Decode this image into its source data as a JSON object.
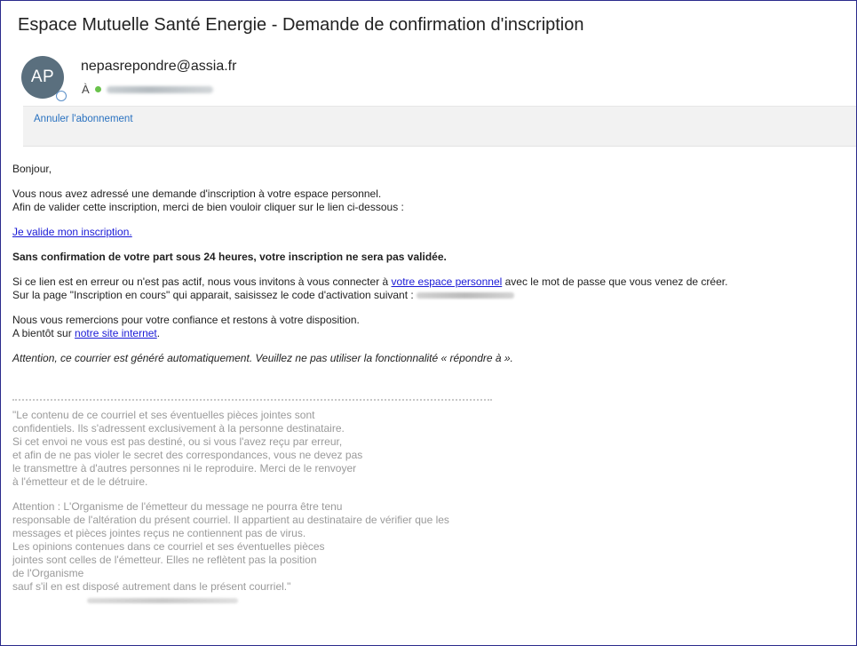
{
  "email": {
    "subject": "Espace Mutuelle Santé Energie - Demande de confirmation d'inscription",
    "avatar_initials": "AP",
    "sender": "nepasrepondre@assia.fr",
    "to_label": "À",
    "unsubscribe_label": "Annuler l'abonnement"
  },
  "body": {
    "greeting": "Bonjour,",
    "intro_line1": "Vous nous avez adressé une demande d'inscription à votre espace personnel.",
    "intro_line2": "Afin de valider cette inscription, merci de bien vouloir cliquer sur le lien ci-dessous :",
    "validate_link": "Je valide mon inscription.",
    "warning": "Sans confirmation de votre part sous 24 heures, votre inscription ne sera pas validée.",
    "error_line_prefix": "Si ce lien est en erreur ou n'est pas actif, nous vous invitons à vous connecter à ",
    "personal_space_link": "votre espace personnel",
    "error_line_suffix": " avec le mot de passe que vous venez de créer.",
    "activation_line": "Sur la page \"Inscription en cours\" qui apparait, saisissez le code d'activation suivant : ",
    "thanks_line1": "Nous vous remercions pour votre confiance et restons à votre disposition.",
    "thanks_line2_prefix": "A bientôt sur ",
    "site_link": "notre site internet",
    "thanks_line2_suffix": ".",
    "auto_notice": "Attention, ce courrier est généré automatiquement. Veuillez ne pas utiliser la fonctionnalité « répondre à »."
  },
  "disclaimer": {
    "para1": [
      "\"Le contenu de ce courriel et ses éventuelles pièces jointes sont",
      "confidentiels. Ils s'adressent exclusivement à la personne destinataire.",
      "Si cet envoi ne vous est pas destiné, ou si vous l'avez reçu par erreur,",
      "et afin de ne pas violer le secret des correspondances, vous ne devez pas",
      "le transmettre à d'autres personnes ni le reproduire. Merci de le renvoyer",
      "à l'émetteur et de le détruire."
    ],
    "para2": [
      "Attention : L'Organisme de l'émetteur du message ne pourra être tenu",
      "responsable de l'altération du présent courriel. Il appartient au destinataire de vérifier que les",
      "messages et pièces jointes reçus ne contiennent pas de virus.",
      "Les opinions contenues dans ce courriel et ses éventuelles pièces",
      "jointes sont celles de l'émetteur. Elles ne reflètent pas la position",
      "de l'Organisme",
      "sauf s'il en est disposé autrement dans le présent courriel.\""
    ]
  },
  "colors": {
    "link": "#1a1ad6",
    "unsubscribe_link": "#2a72c0",
    "avatar_bg": "#5a6f7e",
    "disclaimer_text": "#9a9a9a"
  }
}
